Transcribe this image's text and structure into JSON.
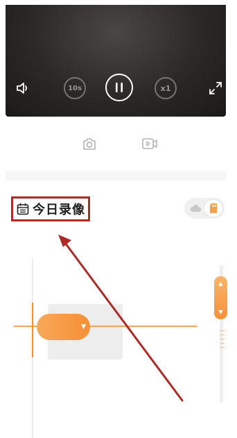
{
  "player": {
    "rewind_label": "10s",
    "speed_label": "x1"
  },
  "section": {
    "title": "今日录像"
  },
  "colors": {
    "accent": "#f7903a",
    "annotation": "#b02a25"
  },
  "icons": {
    "volume": "volume-icon",
    "rewind": "rewind-10s-icon",
    "pause": "pause-icon",
    "speed": "speed-icon",
    "fullscreen": "fullscreen-icon",
    "snapshot": "camera-icon",
    "record": "video-record-icon",
    "calendar": "calendar-icon",
    "cloud": "cloud-icon",
    "sdcard": "sd-card-icon"
  }
}
